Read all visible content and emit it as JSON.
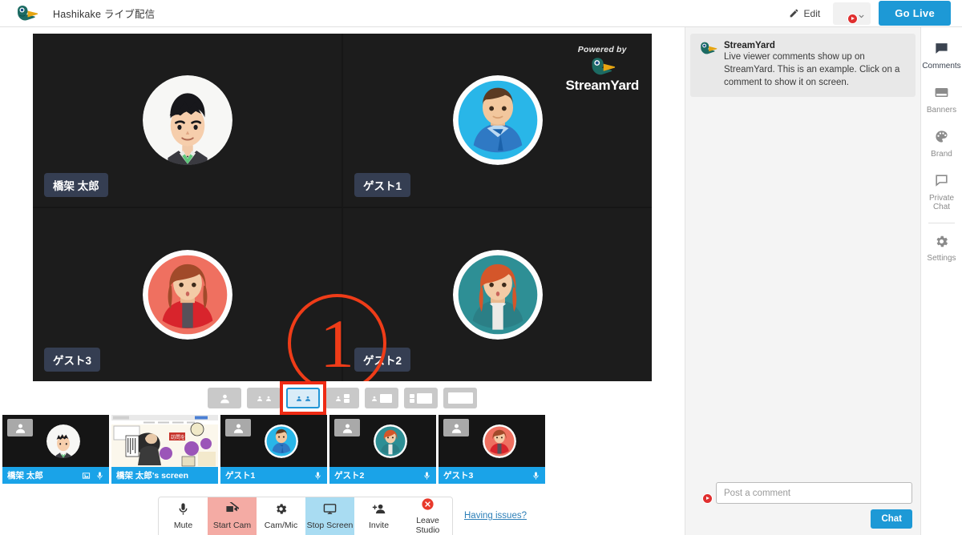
{
  "topbar": {
    "logo_icon": "streamyard-duck-logo",
    "broadcast_title": "Hashikake ライブ配信",
    "edit_label": "Edit",
    "edit_icon": "pencil-icon",
    "destination_icon": "youtube-destination-avatar",
    "dropdown_icon": "chevron-down-icon",
    "golive_label": "Go Live"
  },
  "stage": {
    "watermark": {
      "powered_by": "Powered by",
      "brand": "StreamYard",
      "icon": "streamyard-duck-logo"
    },
    "annotation": {
      "number": "1",
      "color": "#ef3c18"
    },
    "tiles": [
      {
        "name": "橋架 太郎",
        "avatar": "manga-man-black-hair"
      },
      {
        "name": "ゲスト1",
        "avatar": "flat-man-cyan"
      },
      {
        "name": "ゲスト3",
        "avatar": "flat-woman-red"
      },
      {
        "name": "ゲスト2",
        "avatar": "flat-woman-teal"
      }
    ]
  },
  "layouts": {
    "selected_index": 2,
    "options": [
      {
        "name": "layout-solo",
        "kind": "solo"
      },
      {
        "name": "layout-two-side",
        "kind": "two"
      },
      {
        "name": "layout-two-equal",
        "kind": "two-equal"
      },
      {
        "name": "layout-group-strip",
        "kind": "group-strip"
      },
      {
        "name": "layout-person-screen",
        "kind": "person-screen"
      },
      {
        "name": "layout-strip-screen",
        "kind": "strip-screen"
      },
      {
        "name": "layout-screen-only",
        "kind": "screen"
      }
    ]
  },
  "thumbnails": [
    {
      "label": "橋架 太郎",
      "avatar": "manga-man-black-hair",
      "has_image_icon": true,
      "has_mic_icon": true,
      "is_screen": false
    },
    {
      "label": "橋架 太郎's screen",
      "avatar": "",
      "has_image_icon": false,
      "has_mic_icon": false,
      "is_screen": true
    },
    {
      "label": "ゲスト1",
      "avatar": "flat-man-cyan",
      "has_image_icon": false,
      "has_mic_icon": true,
      "is_screen": false
    },
    {
      "label": "ゲスト2",
      "avatar": "flat-woman-teal",
      "has_image_icon": false,
      "has_mic_icon": true,
      "is_screen": false
    },
    {
      "label": "ゲスト3",
      "avatar": "flat-woman-red",
      "has_image_icon": false,
      "has_mic_icon": true,
      "is_screen": false
    }
  ],
  "toolbar": {
    "buttons": [
      {
        "label": "Mute",
        "icon": "microphone-icon",
        "state": "normal"
      },
      {
        "label": "Start Cam",
        "icon": "camera-off-icon",
        "state": "danger"
      },
      {
        "label": "Cam/Mic",
        "icon": "gear-icon",
        "state": "normal"
      },
      {
        "label": "Stop Screen",
        "icon": "monitor-icon",
        "state": "active"
      },
      {
        "label": "Invite",
        "icon": "add-person-icon",
        "state": "normal"
      },
      {
        "label": "Leave Studio",
        "icon": "close-circle-icon",
        "state": "normal"
      }
    ],
    "help_link": "Having issues?"
  },
  "comments": {
    "items": [
      {
        "author": "StreamYard",
        "avatar": "streamyard-duck-logo",
        "text": "Live viewer comments show up on StreamYard. This is an example. Click on a comment to show it on screen."
      }
    ],
    "compose": {
      "avatar": "youtube-destination-avatar",
      "placeholder": "Post a comment",
      "value": "",
      "send_label": "Chat"
    }
  },
  "rail": {
    "items": [
      {
        "label": "Comments",
        "icon": "comment-bubble-icon",
        "active": true
      },
      {
        "label": "Banners",
        "icon": "banner-icon",
        "active": false
      },
      {
        "label": "Brand",
        "icon": "palette-icon",
        "active": false
      },
      {
        "label": "Private Chat",
        "icon": "chat-icon",
        "active": false
      }
    ],
    "settings": {
      "label": "Settings",
      "icon": "gear-icon"
    }
  },
  "colors": {
    "accent_blue": "#1d99d6",
    "thumb_bar_blue": "#1aa3e8",
    "annotation_red": "#ee2b14",
    "danger_bg": "#f4aba4",
    "active_bg": "#a9dcf2",
    "nametag_bg": "#353e52"
  }
}
